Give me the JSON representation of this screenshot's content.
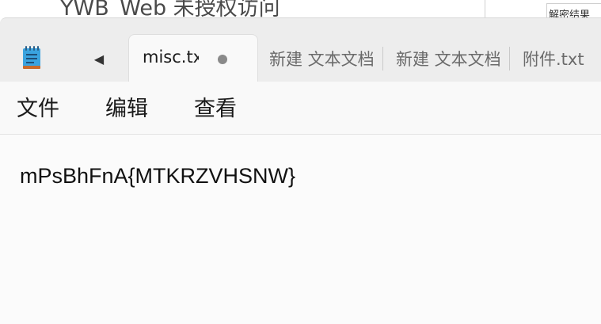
{
  "background_window": {
    "title": "YWB_Web 未授权访问",
    "corner_text": "解密结果"
  },
  "tabs": [
    {
      "label": "misc.txt",
      "active": true,
      "modified": true
    },
    {
      "label": "新建 文本文档",
      "active": false
    },
    {
      "label": "新建 文本文档",
      "active": false
    },
    {
      "label": "附件.txt",
      "active": false
    }
  ],
  "menu": {
    "file": "文件",
    "edit": "编辑",
    "view": "查看"
  },
  "editor": {
    "content": "mPsBhFnA{MTKRZVHSNW}"
  },
  "colors": {
    "tabbar_bg": "#ededed",
    "editor_bg": "#fbfbfb",
    "icon_blue": "#3aa3df",
    "icon_orange": "#c96a2a"
  },
  "icons": {
    "app": "notepad-icon",
    "nav": "chevron-left-icon",
    "modified": "modified-dot-icon"
  }
}
